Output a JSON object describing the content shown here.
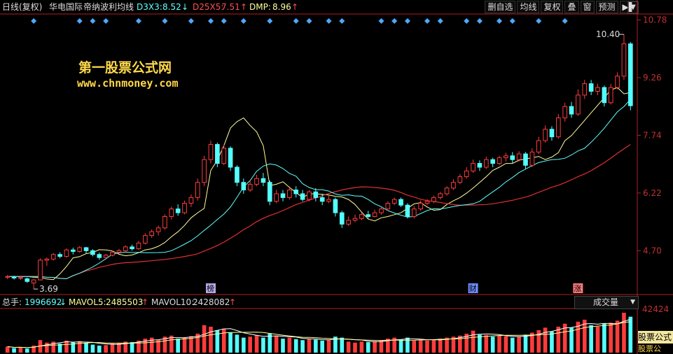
{
  "header": {
    "period": "日线(复权)",
    "stock_name": "华电国际",
    "indicator_name": "帝纳波利均线",
    "d3x3_label": "D3X3:",
    "d3x3_value": "8.52",
    "d3x3_arrow": "↓",
    "d25x5_label": "D25X5:",
    "d25x5_value": "7.51",
    "d25x5_arrow": "↑",
    "dmp_label": "DMP:",
    "dmp_value": "8.96",
    "dmp_arrow": "↑"
  },
  "toolbar": {
    "buttons": [
      "删自选",
      "均线",
      "复权",
      "叠",
      "窗",
      "预测"
    ],
    "nav_icon": "arrow-right-bar-icon",
    "menu_icon": "chevron-down-icon"
  },
  "watermark": {
    "title": "第一股票公式网",
    "url": "www.chnmoney.com"
  },
  "volume_header": {
    "total_label": "总手:",
    "total_value": "1996692",
    "total_arrow": "↓",
    "mavol5_label": "MAVOL5:",
    "mavol5_value": "2485503",
    "mavol5_arrow": "↑",
    "mavol10_label": "MAVOL10:",
    "mavol10_value": "2428082",
    "mavol10_arrow": "↑"
  },
  "volume_select": {
    "value": "成交量"
  },
  "volume_axis": {
    "top_label": "42424"
  },
  "stamp": {
    "text": "股票公式",
    "sub": "股票公"
  },
  "colors": {
    "up": "#ff3c3c",
    "down": "#54ffff",
    "d3x3_line": "#ffffff",
    "d7x5_line": "#60ffff",
    "d25x5_line": "#e03030",
    "dmp_line": "#ffff9a",
    "diamond": "#4fa8ff",
    "accent": "#ffd84a"
  },
  "chart_data": {
    "type": "candlestick",
    "y_ticks": [
      "10.78",
      "9.26",
      "7.74",
      "6.22",
      "4.70"
    ],
    "ylim": [
      3.6,
      10.9
    ],
    "annotations": {
      "high": "10.40",
      "low": "3.69"
    },
    "event_markers": [
      {
        "label": "榜",
        "index": 31,
        "color": "#b8a8e8"
      },
      {
        "label": "财",
        "index": 71,
        "color": "#6c8cff"
      },
      {
        "label": "涨",
        "index": 87,
        "color": "#ff7a7a"
      }
    ],
    "diamond_indices": [
      4,
      11,
      13,
      15,
      20,
      24,
      28,
      31,
      33,
      36,
      40,
      44,
      46,
      49,
      51,
      57,
      59,
      61,
      64,
      66,
      70,
      72,
      75,
      77,
      81,
      85
    ],
    "candles": [
      [
        4.0,
        4.02,
        3.95,
        4.06
      ],
      [
        4.0,
        3.98,
        3.94,
        4.04
      ],
      [
        3.98,
        3.99,
        3.93,
        4.03
      ],
      [
        3.96,
        3.89,
        3.85,
        3.99
      ],
      [
        3.85,
        3.93,
        3.69,
        3.95
      ],
      [
        3.93,
        4.45,
        3.92,
        4.5
      ],
      [
        4.45,
        4.48,
        4.3,
        4.52
      ],
      [
        4.48,
        4.6,
        4.44,
        4.64
      ],
      [
        4.6,
        4.55,
        4.5,
        4.66
      ],
      [
        4.55,
        4.72,
        4.52,
        4.76
      ],
      [
        4.72,
        4.68,
        4.6,
        4.78
      ],
      [
        4.68,
        4.78,
        4.65,
        4.82
      ],
      [
        4.78,
        4.7,
        4.62,
        4.8
      ],
      [
        4.7,
        4.6,
        4.55,
        4.74
      ],
      [
        4.6,
        4.52,
        4.46,
        4.65
      ],
      [
        4.52,
        4.58,
        4.48,
        4.62
      ],
      [
        4.58,
        4.66,
        4.55,
        4.7
      ],
      [
        4.66,
        4.7,
        4.62,
        4.75
      ],
      [
        4.7,
        4.8,
        4.66,
        4.84
      ],
      [
        4.8,
        4.75,
        4.7,
        4.86
      ],
      [
        4.75,
        4.9,
        4.72,
        4.96
      ],
      [
        4.9,
        5.1,
        4.86,
        5.16
      ],
      [
        5.1,
        5.2,
        5.04,
        5.26
      ],
      [
        5.2,
        5.3,
        5.1,
        5.36
      ],
      [
        5.3,
        5.6,
        5.26,
        5.66
      ],
      [
        5.6,
        5.8,
        5.52,
        5.86
      ],
      [
        5.8,
        5.7,
        5.62,
        5.92
      ],
      [
        5.7,
        5.95,
        5.66,
        6.02
      ],
      [
        5.95,
        6.1,
        5.85,
        6.18
      ],
      [
        6.1,
        6.5,
        6.02,
        6.6
      ],
      [
        6.5,
        7.1,
        6.4,
        7.2
      ],
      [
        7.1,
        7.5,
        7.0,
        7.6
      ],
      [
        7.5,
        7.0,
        6.9,
        7.55
      ],
      [
        7.0,
        7.4,
        6.95,
        7.5
      ],
      [
        7.4,
        6.9,
        6.8,
        7.45
      ],
      [
        6.9,
        6.5,
        6.4,
        6.95
      ],
      [
        6.5,
        6.3,
        6.2,
        6.6
      ],
      [
        6.3,
        6.45,
        6.25,
        6.55
      ],
      [
        6.45,
        6.6,
        6.4,
        6.7
      ],
      [
        6.6,
        6.5,
        6.4,
        6.75
      ],
      [
        6.5,
        6.0,
        5.9,
        6.55
      ],
      [
        6.0,
        6.2,
        5.95,
        6.3
      ],
      [
        6.2,
        6.1,
        6.0,
        6.3
      ],
      [
        6.1,
        6.3,
        6.05,
        6.35
      ],
      [
        6.3,
        6.2,
        6.1,
        6.4
      ],
      [
        6.2,
        6.05,
        6.0,
        6.3
      ],
      [
        6.05,
        6.25,
        6.0,
        6.3
      ],
      [
        6.25,
        6.1,
        6.0,
        6.35
      ],
      [
        6.1,
        6.0,
        5.9,
        6.2
      ],
      [
        6.0,
        6.05,
        5.95,
        6.15
      ],
      [
        6.05,
        5.7,
        5.6,
        6.1
      ],
      [
        5.7,
        5.4,
        5.3,
        5.75
      ],
      [
        5.4,
        5.5,
        5.35,
        5.6
      ],
      [
        5.5,
        5.55,
        5.45,
        5.65
      ],
      [
        5.55,
        5.65,
        5.5,
        5.7
      ],
      [
        5.65,
        5.6,
        5.55,
        5.75
      ],
      [
        5.6,
        5.7,
        5.58,
        5.78
      ],
      [
        5.7,
        5.8,
        5.65,
        5.85
      ],
      [
        5.8,
        5.95,
        5.75,
        6.0
      ],
      [
        5.95,
        6.05,
        5.9,
        6.1
      ],
      [
        6.05,
        5.9,
        5.85,
        6.1
      ],
      [
        5.9,
        5.6,
        5.55,
        5.95
      ],
      [
        5.6,
        5.8,
        5.55,
        5.88
      ],
      [
        5.8,
        5.95,
        5.75,
        6.02
      ],
      [
        5.95,
        6.0,
        5.9,
        6.06
      ],
      [
        6.0,
        6.1,
        5.95,
        6.15
      ],
      [
        6.1,
        6.2,
        6.05,
        6.25
      ],
      [
        6.2,
        6.35,
        6.15,
        6.4
      ],
      [
        6.35,
        6.5,
        6.3,
        6.58
      ],
      [
        6.5,
        6.65,
        6.45,
        6.72
      ],
      [
        6.65,
        6.8,
        6.6,
        6.9
      ],
      [
        6.8,
        7.0,
        6.75,
        7.1
      ],
      [
        7.0,
        6.9,
        6.8,
        7.08
      ],
      [
        6.9,
        7.1,
        6.85,
        7.18
      ],
      [
        7.1,
        7.0,
        6.9,
        7.15
      ],
      [
        7.0,
        7.15,
        6.95,
        7.2
      ],
      [
        7.15,
        7.2,
        7.05,
        7.28
      ],
      [
        7.2,
        7.1,
        7.0,
        7.3
      ],
      [
        7.1,
        7.25,
        7.05,
        7.32
      ],
      [
        7.25,
        6.95,
        6.85,
        7.3
      ],
      [
        6.95,
        7.3,
        6.9,
        7.4
      ],
      [
        7.3,
        7.6,
        7.25,
        7.7
      ],
      [
        7.6,
        7.9,
        7.55,
        8.0
      ],
      [
        7.9,
        7.7,
        7.6,
        7.98
      ],
      [
        7.7,
        8.2,
        7.65,
        8.3
      ],
      [
        8.2,
        8.5,
        8.1,
        8.6
      ],
      [
        8.5,
        8.3,
        8.2,
        8.62
      ],
      [
        8.3,
        8.8,
        8.25,
        8.95
      ],
      [
        8.8,
        9.1,
        8.7,
        9.2
      ],
      [
        9.1,
        8.9,
        8.8,
        9.2
      ],
      [
        8.9,
        9.0,
        8.8,
        9.1
      ],
      [
        9.0,
        8.6,
        8.5,
        9.05
      ],
      [
        8.6,
        9.0,
        8.55,
        9.1
      ],
      [
        9.0,
        9.3,
        8.95,
        9.4
      ],
      [
        9.3,
        10.15,
        9.2,
        10.4
      ],
      [
        10.15,
        8.52,
        8.4,
        10.2
      ]
    ],
    "volumes": [
      12,
      9,
      11,
      8,
      14,
      25,
      20,
      22,
      18,
      24,
      21,
      23,
      19,
      16,
      14,
      15,
      18,
      20,
      22,
      21,
      24,
      28,
      30,
      26,
      32,
      34,
      28,
      30,
      33,
      38,
      55,
      52,
      45,
      48,
      40,
      36,
      30,
      32,
      35,
      30,
      38,
      33,
      28,
      30,
      27,
      25,
      28,
      26,
      24,
      25,
      32,
      30,
      22,
      20,
      22,
      21,
      23,
      25,
      28,
      30,
      26,
      30,
      24,
      25,
      24,
      26,
      28,
      30,
      32,
      34,
      38,
      44,
      36,
      35,
      32,
      34,
      33,
      30,
      32,
      36,
      40,
      45,
      50,
      42,
      52,
      58,
      50,
      62,
      66,
      55,
      52,
      58,
      60,
      64,
      80,
      72
    ]
  }
}
